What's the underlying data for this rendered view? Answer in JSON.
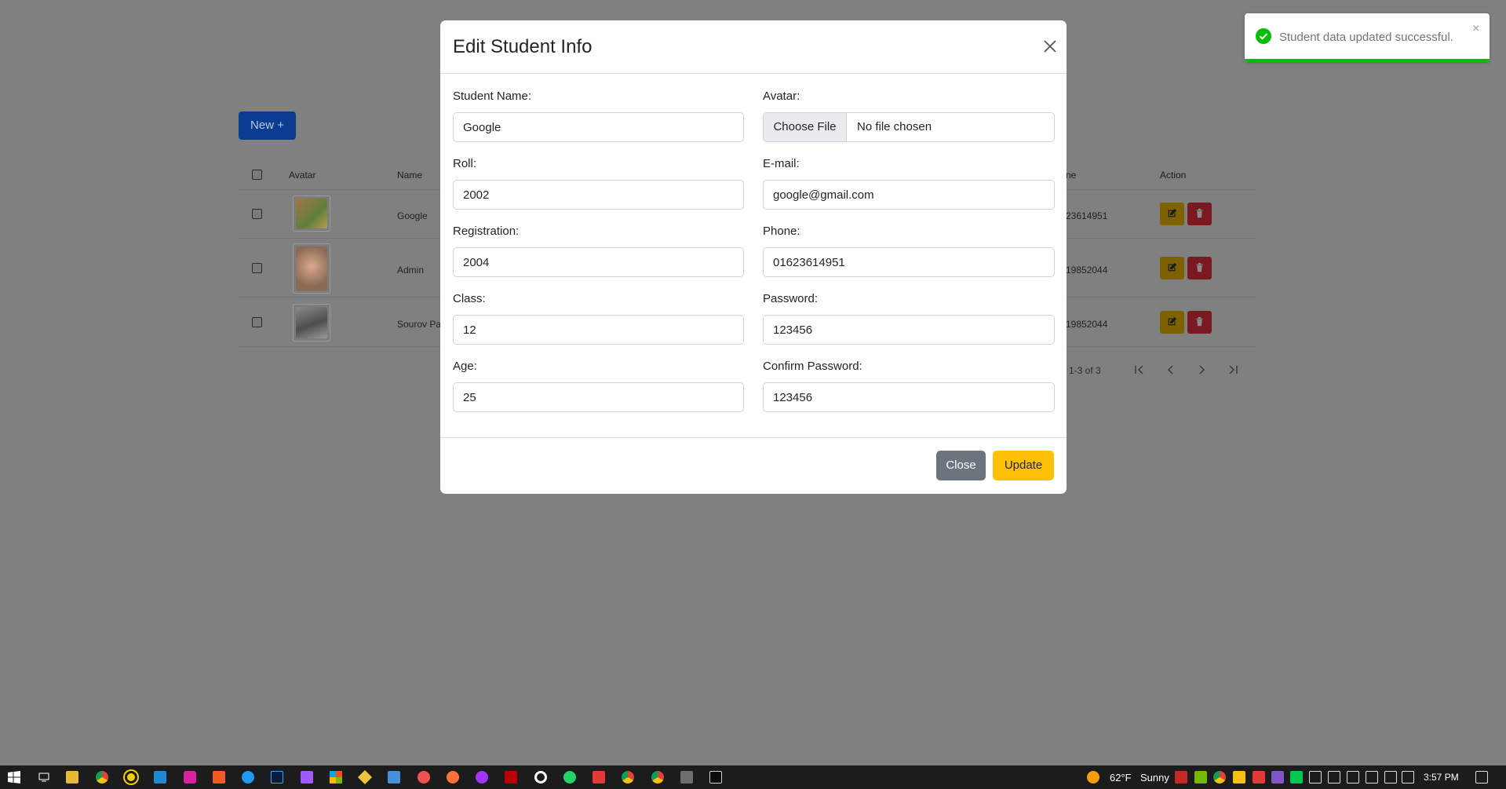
{
  "background": {
    "new_button": "New +",
    "headers": {
      "avatar": "Avatar",
      "name": "Name",
      "phone_partial": "ne",
      "action": "Action"
    },
    "rows": [
      {
        "name": "Google",
        "phone_partial": "23614951",
        "avatar_color": "#8a6a3a"
      },
      {
        "name": "Admin",
        "phone_partial": "19852044",
        "avatar_color": "#b68a6a"
      },
      {
        "name": "Sourov Pa",
        "phone_partial": "19852044",
        "avatar_color": "#6d6d6d"
      }
    ],
    "pagination": {
      "summary": "1-3 of 3"
    }
  },
  "modal": {
    "title": "Edit Student Info",
    "fields": {
      "student_name": {
        "label": "Student Name:",
        "value": "Google"
      },
      "avatar": {
        "label": "Avatar:",
        "button": "Choose File",
        "status": "No file chosen"
      },
      "roll": {
        "label": "Roll:",
        "value": "2002"
      },
      "email": {
        "label": "E-mail:",
        "value": "google@gmail.com"
      },
      "registration": {
        "label": "Registration:",
        "value": "2004"
      },
      "phone": {
        "label": "Phone:",
        "value": "01623614951"
      },
      "class": {
        "label": "Class:",
        "value": "12"
      },
      "password": {
        "label": "Password:",
        "value": "123456"
      },
      "age": {
        "label": "Age:",
        "value": "25"
      },
      "confirm_password": {
        "label": "Confirm Password:",
        "value": "123456"
      }
    },
    "footer": {
      "close": "Close",
      "update": "Update"
    }
  },
  "toast": {
    "message": "Student data updated successful.",
    "progress": 1.0,
    "color": "#07bc0c"
  },
  "taskbar": {
    "weather": "62°F",
    "condition": "Sunny",
    "time": "3:57 PM"
  },
  "colors": {
    "primary": "#0d6efd",
    "warning": "#ffc107",
    "secondary": "#6c757d",
    "danger": "#dc3545",
    "success": "#07bc0c"
  }
}
